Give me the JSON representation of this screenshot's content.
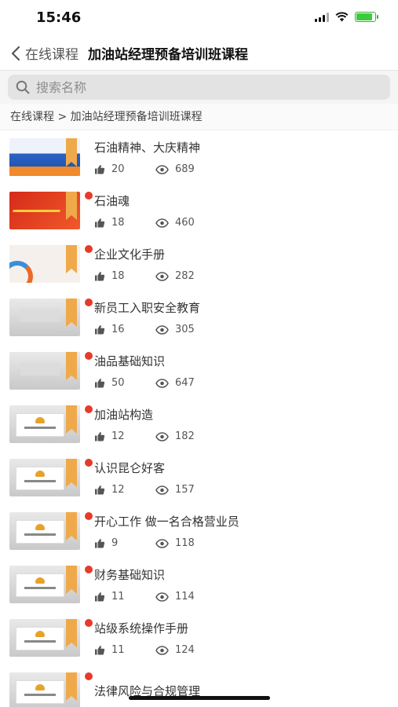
{
  "status_bar": {
    "time": "15:46"
  },
  "nav": {
    "back_label": "在线课程",
    "title": "加油站经理预备培训班课程"
  },
  "search": {
    "placeholder": "搜索名称"
  },
  "breadcrumb": "在线课程 > 加油站经理预备培训班课程",
  "courses": [
    {
      "title": "石油精神、大庆精神",
      "likes": "20",
      "views": "689",
      "thumb_style": "blue",
      "badge": false
    },
    {
      "title": "石油魂",
      "likes": "18",
      "views": "460",
      "thumb_style": "red",
      "badge": true
    },
    {
      "title": "企业文化手册",
      "likes": "18",
      "views": "282",
      "thumb_style": "light",
      "badge": true
    },
    {
      "title": "新员工入职安全教育",
      "likes": "16",
      "views": "305",
      "thumb_style": "dark",
      "badge": true
    },
    {
      "title": "油品基础知识",
      "likes": "50",
      "views": "647",
      "thumb_style": "dark",
      "badge": true
    },
    {
      "title": "加油站构造",
      "likes": "12",
      "views": "182",
      "thumb_style": "slide",
      "badge": true
    },
    {
      "title": "认识昆仑好客",
      "likes": "12",
      "views": "157",
      "thumb_style": "slide",
      "badge": true
    },
    {
      "title": "开心工作 做一名合格营业员",
      "likes": "9",
      "views": "118",
      "thumb_style": "slide",
      "badge": true
    },
    {
      "title": "财务基础知识",
      "likes": "11",
      "views": "114",
      "thumb_style": "slide",
      "badge": true
    },
    {
      "title": "站级系统操作手册",
      "likes": "11",
      "views": "124",
      "thumb_style": "slide",
      "badge": true
    },
    {
      "title": "法律风险与合规管理",
      "likes": "",
      "views": "",
      "thumb_style": "slide",
      "badge": true
    }
  ],
  "colors": {
    "badge": "#e63a2a",
    "ribbon": "#f0a94a"
  }
}
